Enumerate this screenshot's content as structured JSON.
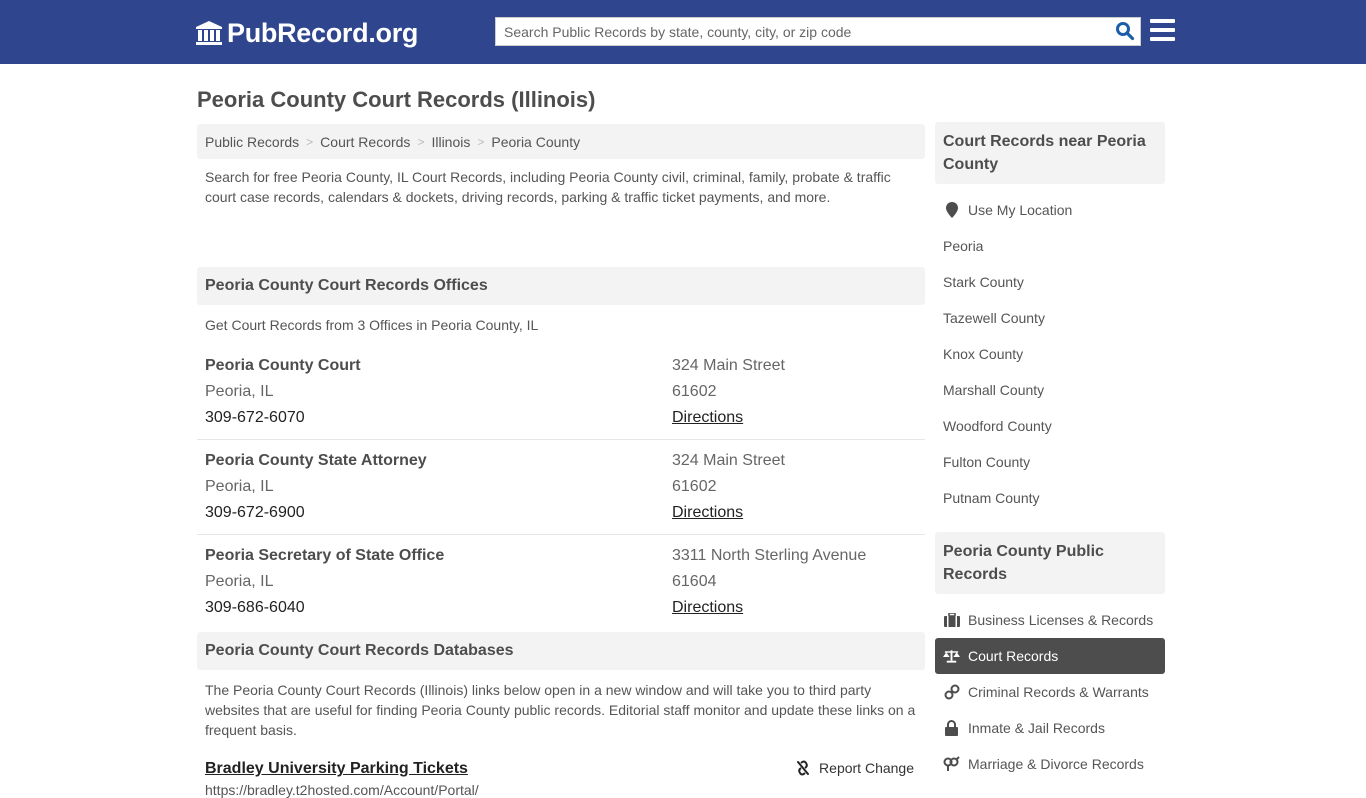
{
  "header": {
    "logo_text": "PubRecord.org",
    "search_placeholder": "Search Public Records by state, county, city, or zip code",
    "brand_color": "#2f468f"
  },
  "page_title": "Peoria County Court Records (Illinois)",
  "breadcrumb": [
    "Public Records",
    "Court Records",
    "Illinois",
    "Peoria County"
  ],
  "intro": "Search for free Peoria County, IL Court Records, including Peoria County civil, criminal, family, probate & traffic court case records, calendars & dockets, driving records, parking & traffic ticket payments, and more.",
  "offices": {
    "heading": "Peoria County Court Records Offices",
    "subheading": "Get Court Records from 3 Offices in Peoria County, IL",
    "items": [
      {
        "name": "Peoria County Court",
        "city": "Peoria, IL",
        "phone": "309-672-6070",
        "address": "324 Main Street",
        "zip": "61602",
        "directions": "Directions"
      },
      {
        "name": "Peoria County State Attorney",
        "city": "Peoria, IL",
        "phone": "309-672-6900",
        "address": "324 Main Street",
        "zip": "61602",
        "directions": "Directions"
      },
      {
        "name": "Peoria Secretary of State Office",
        "city": "Peoria, IL",
        "phone": "309-686-6040",
        "address": "3311 North Sterling Avenue",
        "zip": "61604",
        "directions": "Directions"
      }
    ]
  },
  "databases": {
    "heading": "Peoria County Court Records Databases",
    "description": "The Peoria County Court Records (Illinois) links below open in a new window and will take you to third party websites that are useful for finding Peoria County public records. Editorial staff monitor and update these links on a frequent basis.",
    "items": [
      {
        "title": "Bradley University Parking Tickets",
        "url": "https://bradley.t2hosted.com/Account/Portal/",
        "report_label": "Report Change"
      }
    ]
  },
  "sidebar": {
    "nearby": {
      "heading": "Court Records near Peoria County",
      "use_location": "Use My Location",
      "items": [
        "Peoria",
        "Stark County",
        "Tazewell County",
        "Knox County",
        "Marshall County",
        "Woodford County",
        "Fulton County",
        "Putnam County"
      ]
    },
    "public_records": {
      "heading": "Peoria County Public Records",
      "items": [
        {
          "label": "Business Licenses & Records",
          "icon": "briefcase-icon",
          "active": false
        },
        {
          "label": "Court Records",
          "icon": "balance-scale-icon",
          "active": true
        },
        {
          "label": "Criminal Records & Warrants",
          "icon": "handcuffs-icon",
          "active": false
        },
        {
          "label": "Inmate & Jail Records",
          "icon": "lock-icon",
          "active": false
        },
        {
          "label": "Marriage & Divorce Records",
          "icon": "venus-mars-icon",
          "active": false
        }
      ]
    }
  }
}
